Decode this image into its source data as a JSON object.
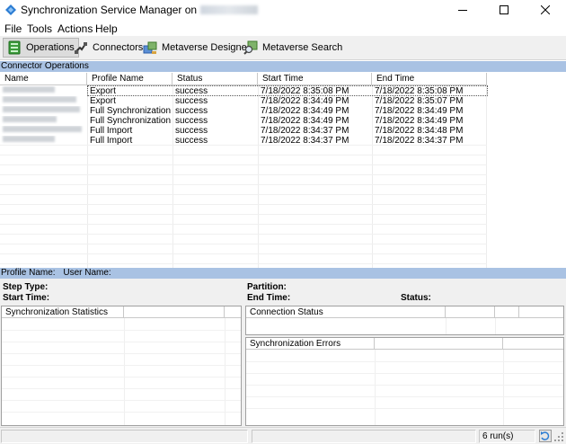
{
  "window": {
    "title": "Synchronization Service Manager on",
    "controls": {
      "minimize_icon": "minimize-icon",
      "maximize_icon": "maximize-icon",
      "close_icon": "close-icon"
    }
  },
  "menu": {
    "items": [
      "File",
      "Tools",
      "Actions",
      "Help"
    ]
  },
  "toolbar": {
    "buttons": [
      {
        "label": "Operations",
        "icon": "operations-icon"
      },
      {
        "label": "Connectors",
        "icon": "connectors-icon"
      },
      {
        "label": "Metaverse Designer",
        "icon": "metaverse-designer-icon"
      },
      {
        "label": "Metaverse Search",
        "icon": "metaverse-search-icon"
      }
    ]
  },
  "operations": {
    "header": "Connector Operations",
    "columns": [
      "Name",
      "Profile Name",
      "Status",
      "Start Time",
      "End Time"
    ],
    "rows": [
      {
        "profile": "Export",
        "status": "success",
        "start": "7/18/2022 8:35:08 PM",
        "end": "7/18/2022 8:35:08 PM"
      },
      {
        "profile": "Export",
        "status": "success",
        "start": "7/18/2022 8:34:49 PM",
        "end": "7/18/2022 8:35:07 PM"
      },
      {
        "profile": "Full Synchronization",
        "status": "success",
        "start": "7/18/2022 8:34:49 PM",
        "end": "7/18/2022 8:34:49 PM"
      },
      {
        "profile": "Full Synchronization",
        "status": "success",
        "start": "7/18/2022 8:34:49 PM",
        "end": "7/18/2022 8:34:49 PM"
      },
      {
        "profile": "Full Import",
        "status": "success",
        "start": "7/18/2022 8:34:37 PM",
        "end": "7/18/2022 8:34:48 PM"
      },
      {
        "profile": "Full Import",
        "status": "success",
        "start": "7/18/2022 8:34:37 PM",
        "end": "7/18/2022 8:34:37 PM"
      }
    ]
  },
  "details": {
    "header_profile": "Profile Name:",
    "header_user": "User Name:",
    "step_type": "Step Type:",
    "start_time": "Start Time:",
    "partition": "Partition:",
    "end_time": "End Time:",
    "status": "Status:",
    "sync_stats": "Synchronization Statistics",
    "connection_status": "Connection Status",
    "sync_errors": "Synchronization Errors"
  },
  "statusbar": {
    "runs": "6 run(s)"
  },
  "colors": {
    "section_header": "#a9c2e3",
    "toolbar": "#f0f0f0"
  }
}
